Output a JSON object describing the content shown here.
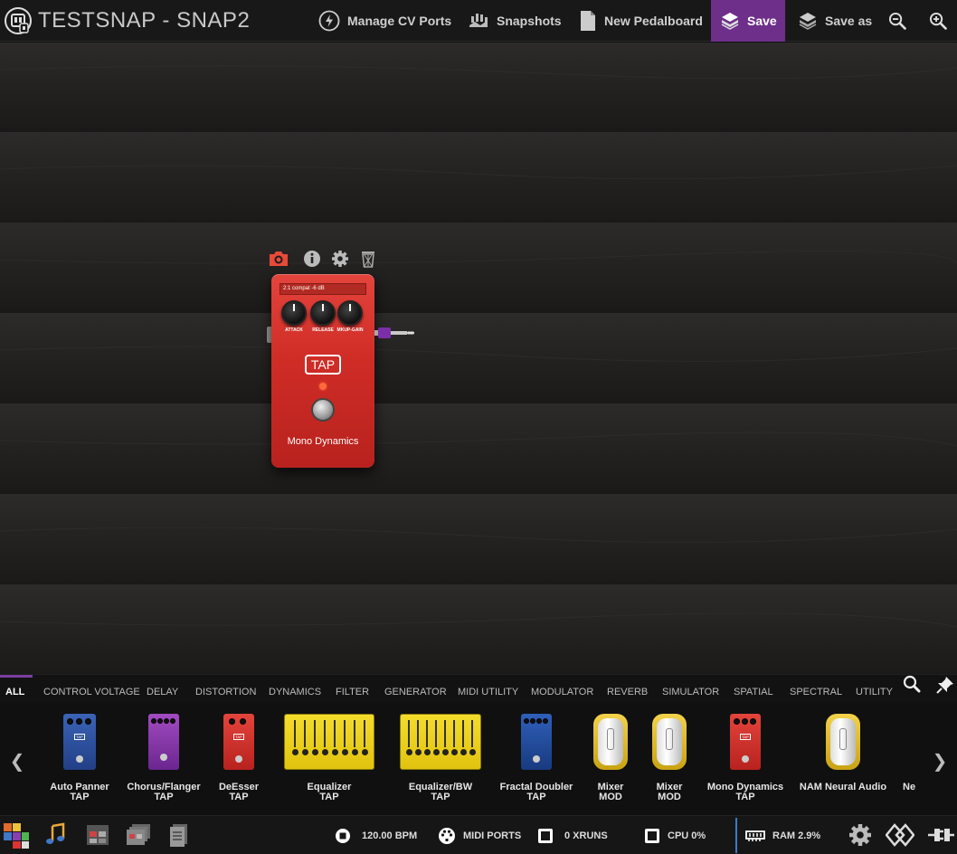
{
  "header": {
    "title": "TESTSNAP - SNAP2",
    "buttons": {
      "cv_ports": "Manage CV Ports",
      "snapshots": "Snapshots",
      "new_pedalboard": "New Pedalboard",
      "save": "Save",
      "save_as": "Save as"
    },
    "icons": [
      "logo-icon",
      "lightning-icon",
      "snapshots-icon",
      "document-icon",
      "save-icon",
      "save-as-icon",
      "zoom-out-icon",
      "zoom-in-icon"
    ],
    "colors": {
      "save_bg": "#6e2f8a"
    }
  },
  "pedal": {
    "preset": "2:1 compat -6 dB",
    "knobs": [
      "ATTACK",
      "RELEASE",
      "MKUP-GAIN"
    ],
    "badge": "TAP",
    "name": "Mono Dynamics",
    "tools": [
      "camera-icon",
      "info-icon",
      "settings-icon",
      "trash-icon"
    ],
    "color": "#d3302a",
    "output_cable_color": "#7a2fa8"
  },
  "categories": {
    "items": [
      "ALL",
      "CONTROL VOLTAGE",
      "DELAY",
      "DISTORTION",
      "DYNAMICS",
      "FILTER",
      "GENERATOR",
      "MIDI UTILITY",
      "MODULATOR",
      "REVERB",
      "SIMULATOR",
      "SPATIAL",
      "SPECTRAL",
      "UTILITY"
    ],
    "active": "ALL",
    "active_color": "#7b3ea0"
  },
  "plugins": [
    {
      "name": "Auto Panner",
      "brand": "TAP"
    },
    {
      "name": "Chorus/Flanger",
      "brand": "TAP"
    },
    {
      "name": "DeEsser",
      "brand": "TAP"
    },
    {
      "name": "Equalizer",
      "brand": "TAP"
    },
    {
      "name": "Equalizer/BW",
      "brand": "TAP"
    },
    {
      "name": "Fractal Doubler",
      "brand": "TAP"
    },
    {
      "name": "Mixer",
      "brand": "MOD"
    },
    {
      "name": "Mixer",
      "brand": "MOD"
    },
    {
      "name": "Mono Dynamics",
      "brand": "TAP"
    },
    {
      "name": "NAM Neural Audio",
      "brand": ""
    },
    {
      "name": "Ne",
      "brand": ""
    }
  ],
  "status": {
    "bpm": "120.00 BPM",
    "midi": "MIDI PORTS",
    "xruns": "0 XRUNS",
    "cpu": "CPU 0%",
    "ram": "RAM 2.9%",
    "ram_color": "#3f78c6"
  }
}
